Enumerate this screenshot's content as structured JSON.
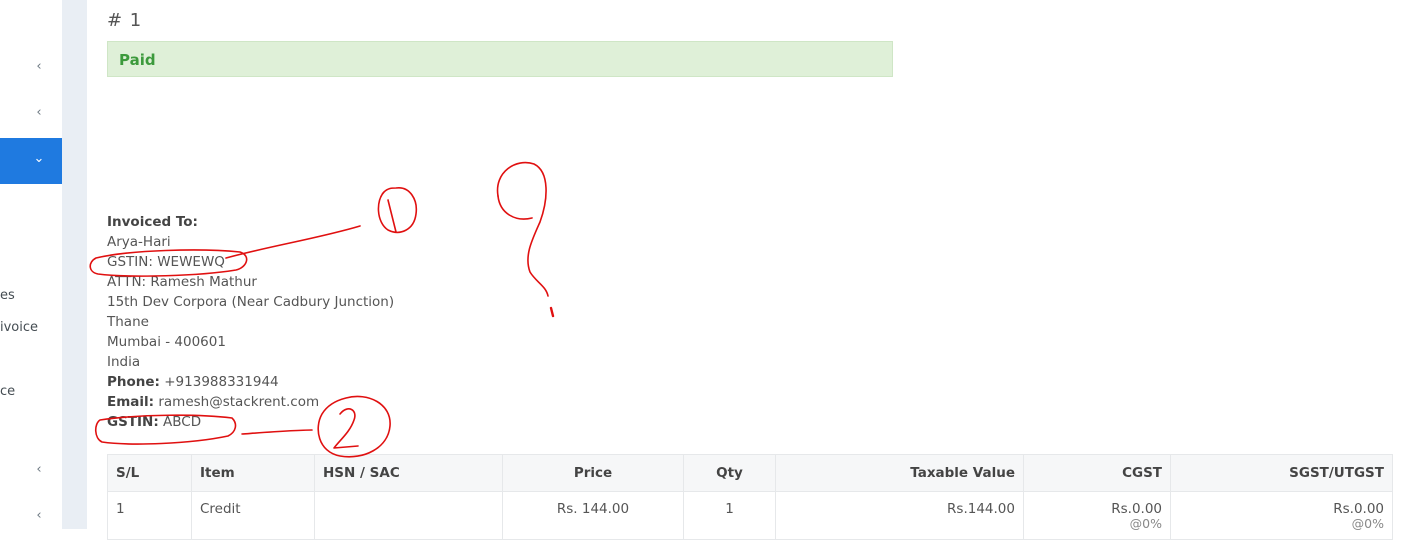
{
  "sidebar": {
    "fragments": [
      "es",
      "ivoice",
      "ce"
    ]
  },
  "invoice": {
    "number": "# 1",
    "status": "Paid"
  },
  "invoiced_to": {
    "heading": "Invoiced To:",
    "name": "Arya-Hari",
    "gstin_line": "GSTIN: WEWEWQ",
    "attn": "ATTN: Ramesh Mathur",
    "address1": "15th Dev Corpora (Near Cadbury Junction)",
    "city": "Thane",
    "city_pin": "Mumbai - 400601",
    "country": "India",
    "phone_label": "Phone:",
    "phone": "+913988331944",
    "email_label": "Email:",
    "email": "ramesh@stackrent.com",
    "gstin_label": "GSTIN:",
    "gstin": "ABCD"
  },
  "items_table": {
    "headers": [
      "S/L",
      "Item",
      "HSN / SAC",
      "Price",
      "Qty",
      "Taxable Value",
      "CGST",
      "SGST/UTGST"
    ],
    "rows": [
      {
        "sl": "1",
        "item": "Credit",
        "hsn": "",
        "price": "Rs. 144.00",
        "qty": "1",
        "taxable": "Rs.144.00",
        "cgst": "Rs.0.00",
        "cgst_rate": "@0%",
        "sgst": "Rs.0.00",
        "sgst_rate": "@0%"
      }
    ]
  },
  "annotations": {
    "mark_1": "1",
    "mark_2": "2",
    "mark_q": "?"
  },
  "colors": {
    "accent": "#1f7ae0",
    "paid_bg": "#dff0d8",
    "paid_text": "#3c9a3c",
    "annotation": "#e01010"
  }
}
